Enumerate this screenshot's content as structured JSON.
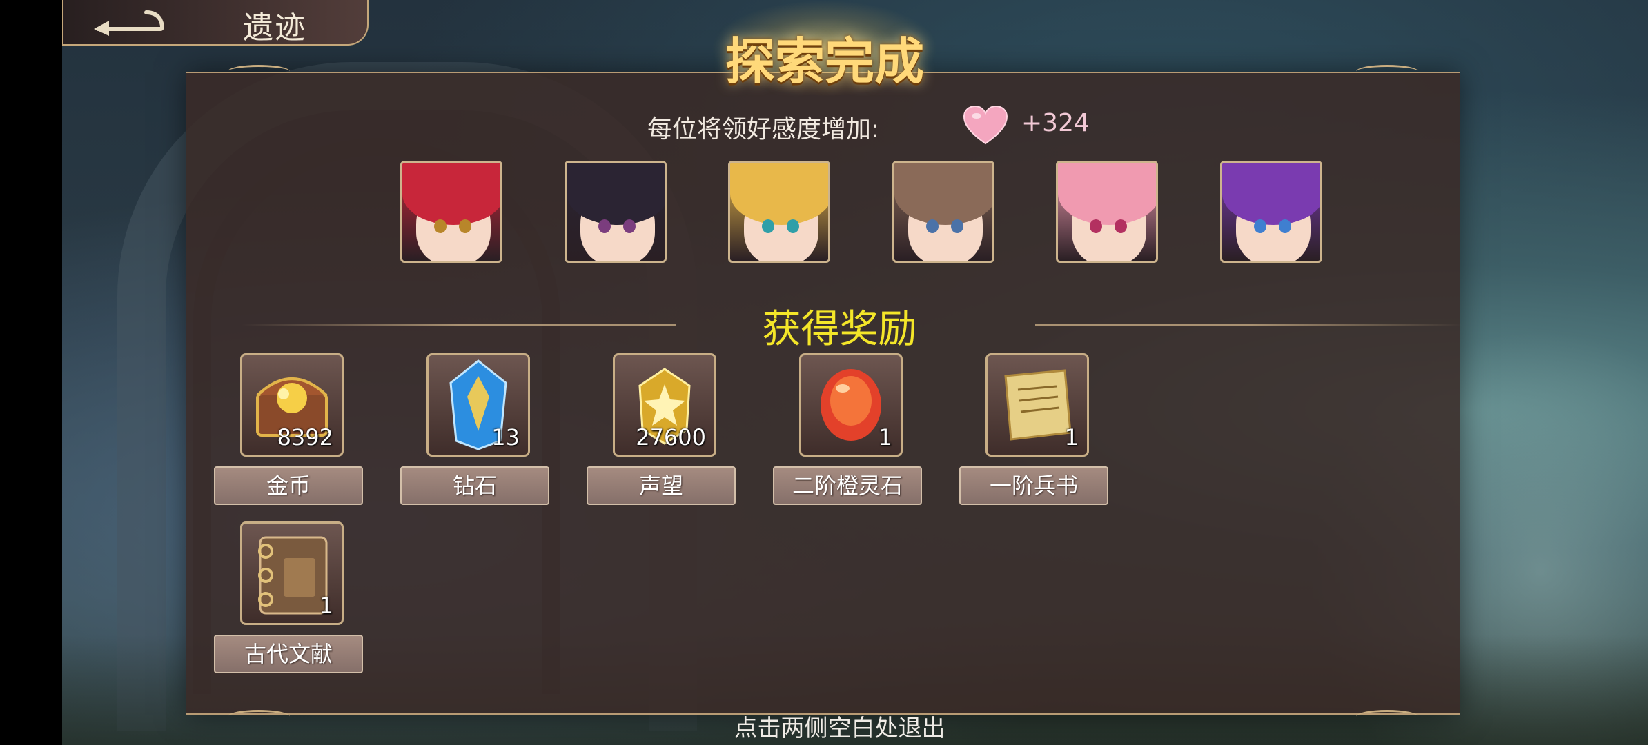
{
  "header": {
    "back_icon": "back-arrow-icon",
    "title": "遗迹"
  },
  "banner": {
    "title": "探索完成"
  },
  "affection": {
    "label": "每位将领好感度增加:",
    "icon": "heart-icon",
    "value": "+324"
  },
  "heroes": [
    {
      "hair": "#c8263a",
      "eye": "#b8862a"
    },
    {
      "hair": "#2b2433",
      "eye": "#7b3d7e"
    },
    {
      "hair": "#e8b84a",
      "eye": "#2f9fa8"
    },
    {
      "hair": "#8a6a58",
      "eye": "#4b72a8"
    },
    {
      "hair": "#f09ab0",
      "eye": "#b33060"
    },
    {
      "hair": "#7a3bb0",
      "eye": "#3f7fd0"
    }
  ],
  "rewards": {
    "title": "获得奖励",
    "items": [
      {
        "name": "金币",
        "qty": "8392",
        "icon": "treasure-chest-icon"
      },
      {
        "name": "钻石",
        "qty": "13",
        "icon": "diamond-crystal-icon"
      },
      {
        "name": "声望",
        "qty": "27600",
        "icon": "prestige-medal-icon"
      },
      {
        "name": "二阶橙灵石",
        "qty": "1",
        "icon": "orange-spirit-stone-icon"
      },
      {
        "name": "一阶兵书",
        "qty": "1",
        "icon": "scroll-icon"
      },
      {
        "name": "古代文献",
        "qty": "1",
        "icon": "ancient-book-icon"
      }
    ]
  },
  "footer": {
    "hint": "点击两侧空白处退出"
  },
  "colors": {
    "reward_title": "#f4e629",
    "banner_gold": "#ffd97a",
    "panel": "#3a2a26"
  }
}
